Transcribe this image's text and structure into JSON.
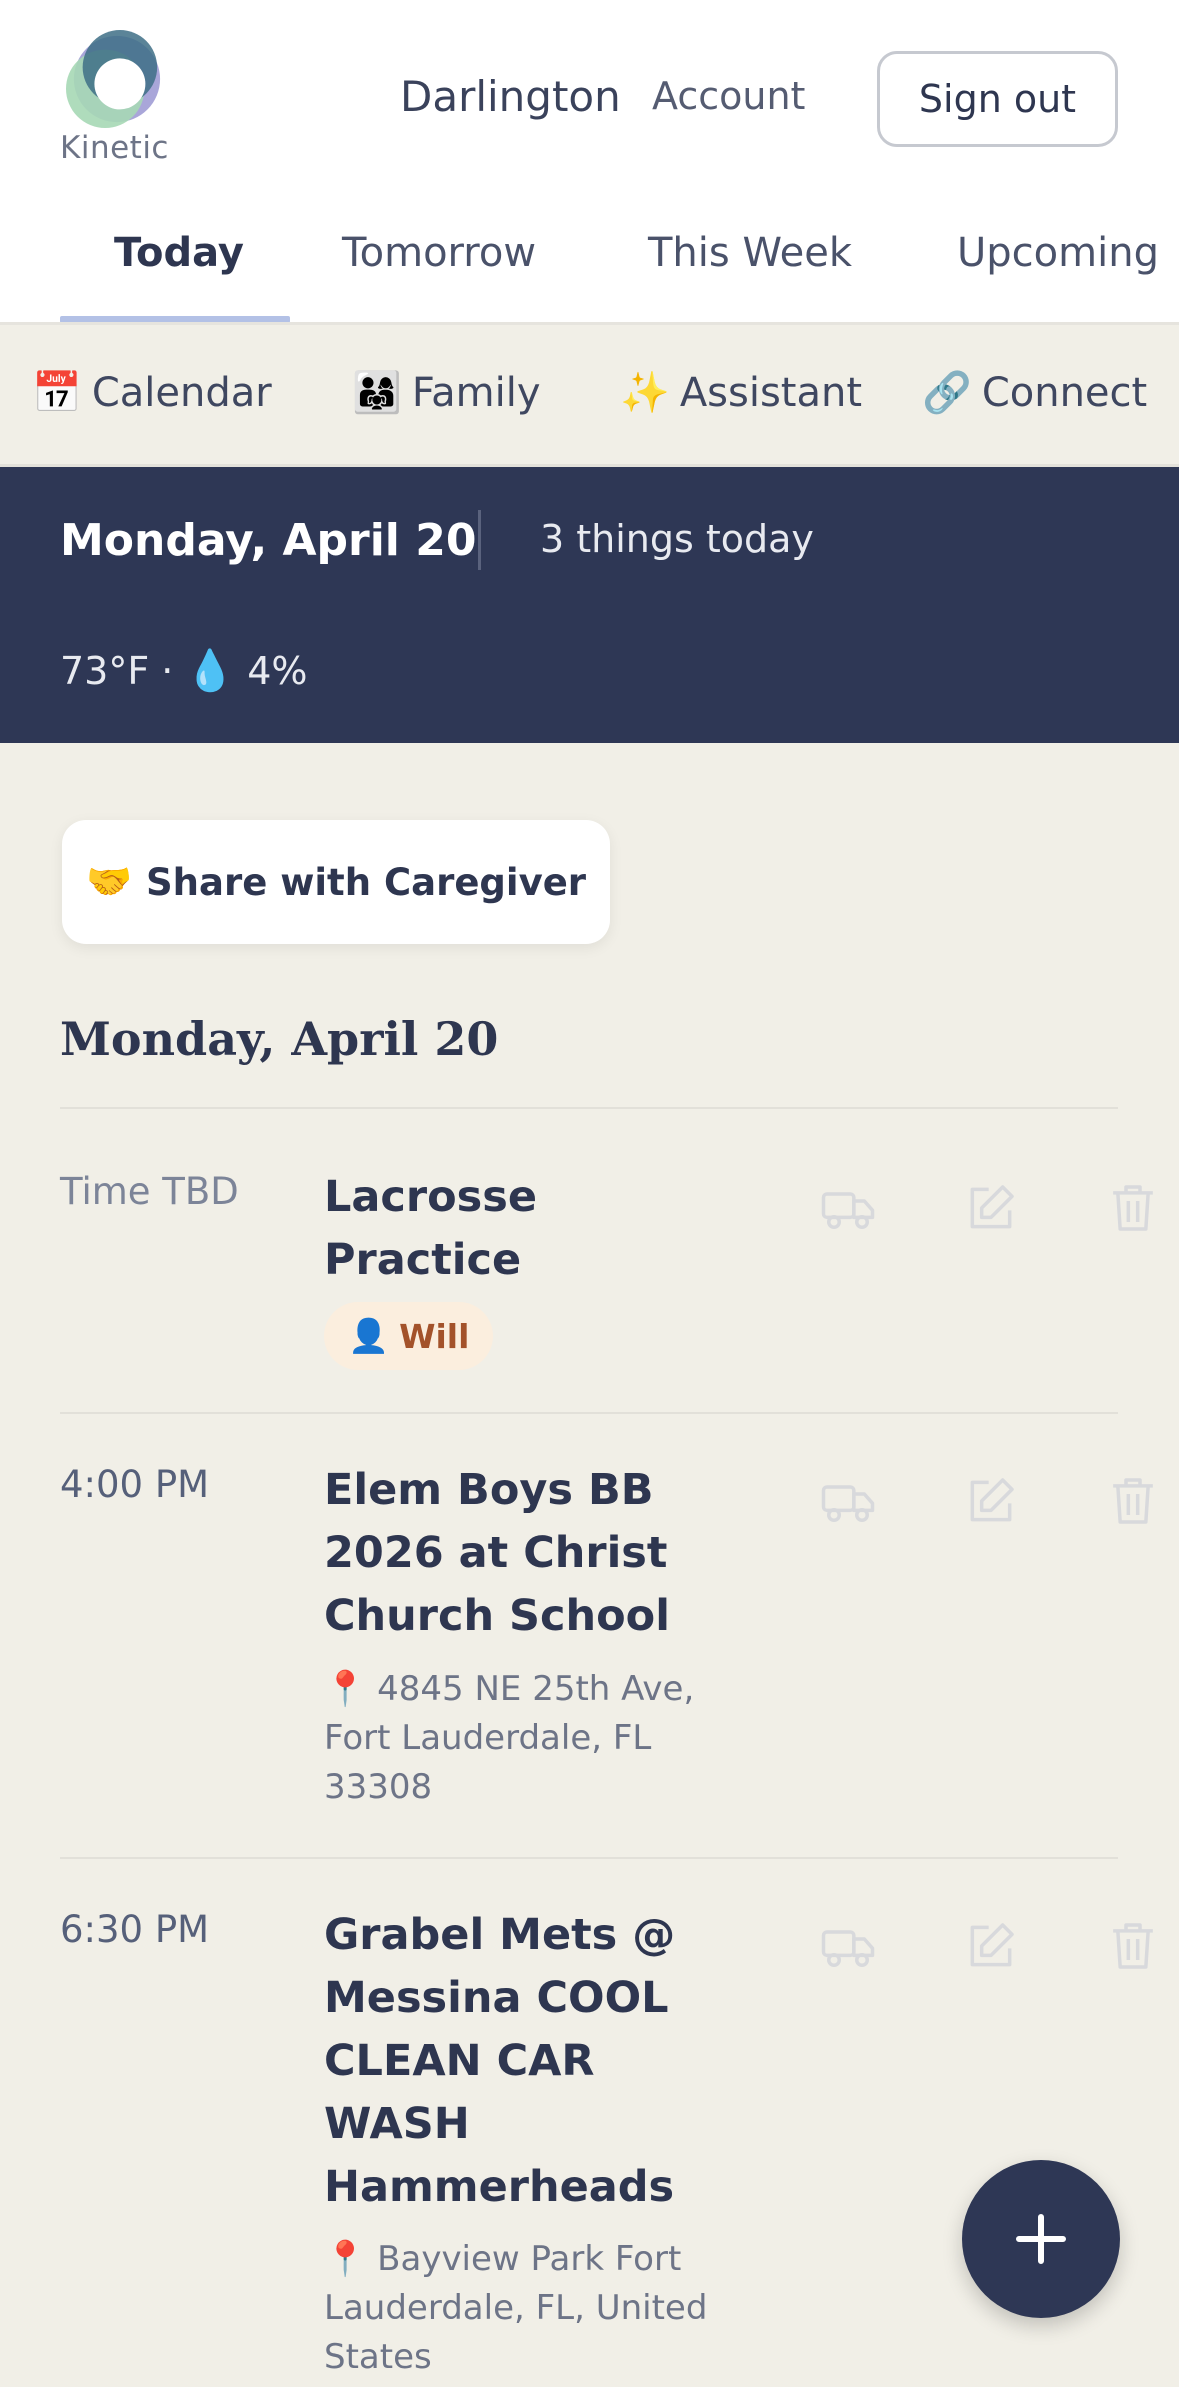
{
  "header": {
    "logo_text": "Kinetic",
    "user_name": "Darlington",
    "account_label": "Account",
    "signout_label": "Sign out"
  },
  "tabs": [
    {
      "label": "Today",
      "active": true
    },
    {
      "label": "Tomorrow",
      "active": false
    },
    {
      "label": "This Week",
      "active": false
    },
    {
      "label": "Upcoming",
      "active": false
    }
  ],
  "subnav": [
    {
      "emoji": "📅",
      "label": "Calendar"
    },
    {
      "emoji": "👨‍👩‍👧",
      "label": "Family"
    },
    {
      "emoji": "✨",
      "label": "Assistant"
    },
    {
      "emoji": "🔗",
      "label": "Connect"
    }
  ],
  "banner": {
    "date": "Monday, April 20",
    "count": "3 things today",
    "temp": "73°F ·",
    "drop_emoji": "💧",
    "precip": "4%"
  },
  "share": {
    "emoji": "🤝",
    "label": "Share with Caregiver"
  },
  "day_heading": "Monday, April 20",
  "events": [
    {
      "time": "Time TBD",
      "title": "Lacrosse Practice",
      "badge_emoji": "👤",
      "badge": "Will",
      "location": ""
    },
    {
      "time": "4:00 PM",
      "title": "Elem Boys BB 2026 at Christ Church School",
      "badge": "",
      "location_pin": "📍",
      "location": "4845 NE 25th Ave, Fort Lauderdale, FL 33308"
    },
    {
      "time": "6:30 PM",
      "title": "Grabel Mets @ Messina COOL CLEAN CAR WASH Hammerheads",
      "badge": "",
      "location_pin": "📍",
      "location": "Bayview Park Fort Lauderdale, FL, United States"
    }
  ],
  "colors": {
    "navy": "#2e3755",
    "background": "#f1efe7",
    "badge_bg": "#fbeede",
    "badge_text": "#a3522a",
    "tab_underline": "#b3c1e6"
  },
  "icons": [
    "kinetic-logo-icon",
    "car-icon",
    "edit-icon",
    "trash-icon",
    "plus-icon"
  ]
}
